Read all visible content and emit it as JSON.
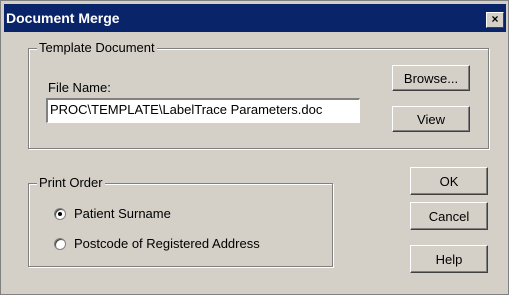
{
  "window": {
    "title": "Document Merge",
    "close_glyph": "×"
  },
  "template": {
    "legend": "Template Document",
    "file_name_label": "File Name:",
    "file_name_value": "PROC\\TEMPLATE\\LabelTrace Parameters.doc",
    "browse_label": "Browse...",
    "view_label": "View"
  },
  "print_order": {
    "legend": "Print Order",
    "options": [
      {
        "label": "Patient Surname",
        "selected": true
      },
      {
        "label": "Postcode of Registered Address",
        "selected": false
      }
    ]
  },
  "buttons": {
    "ok": "OK",
    "cancel": "Cancel",
    "help": "Help"
  },
  "colors": {
    "titlebar": "#0a246a",
    "face": "#d4d0c8"
  }
}
